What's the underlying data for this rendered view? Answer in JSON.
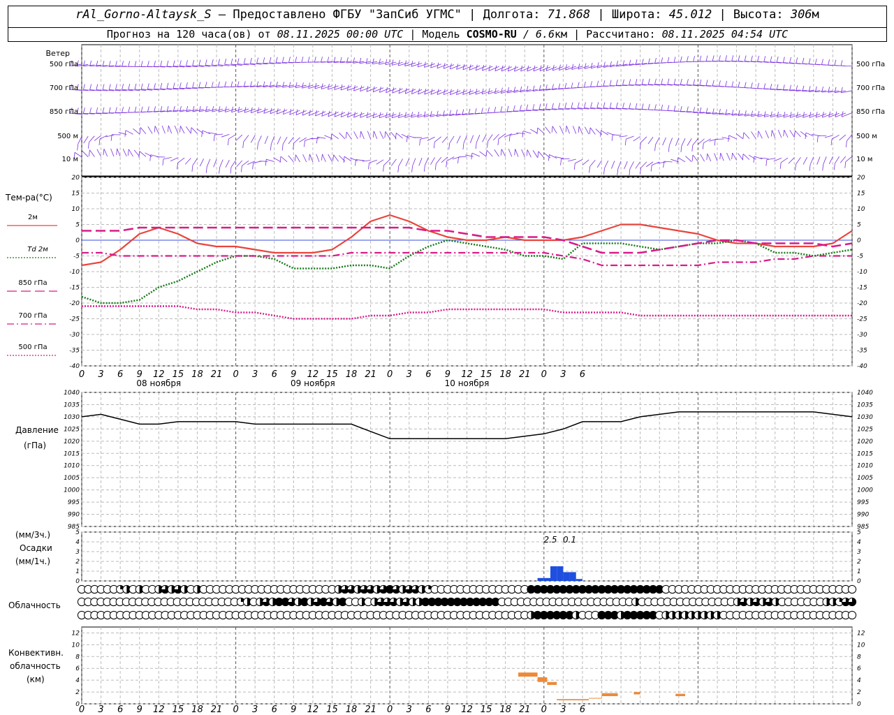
{
  "header": {
    "station": "rAl_Gorno-Altaysk_S",
    "provider_prefix": "— Предоставлено ФГБУ \"ЗапСиб УГМС\" | Долгота:",
    "longitude": "71.868",
    "lat_label": "| Широта:",
    "latitude": "45.012",
    "alt_label": "| Высота:",
    "altitude": "306",
    "alt_unit": "м",
    "forecast_prefix": "Прогноз на 120 часа(ов) от",
    "run_time": "08.11.2025 00:00 UTC",
    "model_label": "| Модель",
    "model_name": "COSMO-RU",
    "model_res": "/ 6.6",
    "model_res_unit": "км",
    "computed_label": "| Рассчитано:",
    "computed_time": "08.11.2025 04:54 UTC"
  },
  "labels": {
    "wind": "Ветер",
    "wind_levels": [
      "500 гПа",
      "700 гПа",
      "850 гПа",
      "500 м",
      "10  м"
    ],
    "temp_title": "Тем-ра(°C)",
    "temp_legend": [
      "2м",
      "Td  2м",
      "850 гПа",
      "700 гПа",
      "500 гПа"
    ],
    "pressure_title": "Давление",
    "pressure_unit": "(гПа)",
    "precip_unit_3h": "(мм/3ч.)",
    "precip_title": "Осадки",
    "precip_unit_1h": "(мм/1ч.)",
    "cloud_title": "Облачность",
    "conv_title_1": "Конвективн.",
    "conv_title_2": "облачность",
    "conv_unit": "(км)",
    "day_labels": [
      "08 ноября",
      "09 ноября",
      "10 ноября"
    ],
    "precip_value_labels": [
      "2.5",
      "0.1"
    ]
  },
  "colors": {
    "t2m": "#e8453c",
    "td2m": "#1a7a1a",
    "t850": "#d81b8a",
    "t700": "#d81b8a",
    "t500": "#d81b8a",
    "pressure": "#000000",
    "precip": "#1f4fe0",
    "conv": "#ec8a3a",
    "wind": "#7a2ee0",
    "zero_line": "#3a4ddb"
  },
  "chart_data": [
    {
      "type": "line",
      "title": "Тем-ра(°C)",
      "x_hours": [
        0,
        3,
        6,
        9,
        12,
        15,
        18,
        21,
        24,
        27,
        30,
        33,
        36,
        39,
        42,
        45,
        48,
        51,
        54,
        57,
        60,
        63,
        66,
        69,
        72,
        75,
        78,
        81,
        84,
        87,
        90,
        93,
        96,
        99,
        102,
        105,
        108,
        111,
        114,
        117,
        120
      ],
      "x_ticks": [
        "0",
        "3",
        "6",
        "9",
        "12",
        "15",
        "18",
        "21",
        "0",
        "3",
        "6",
        "9",
        "12",
        "15",
        "18",
        "21",
        "0",
        "3",
        "6",
        "9",
        "12",
        "15",
        "18",
        "21",
        "0",
        "3",
        "6"
      ],
      "ylim": [
        -40,
        20
      ],
      "yticks": [
        -40,
        -35,
        -30,
        -25,
        -20,
        -15,
        -10,
        -5,
        0,
        5,
        10,
        15,
        20
      ],
      "series": [
        {
          "name": "2м",
          "style": "solid",
          "values": [
            -8,
            -7,
            -3,
            2,
            4,
            2,
            -1,
            -2,
            -2,
            -3,
            -4,
            -4,
            -4,
            -3,
            1,
            6,
            8,
            6,
            3,
            1,
            0,
            0,
            1,
            0,
            0,
            0,
            1,
            3,
            5,
            5,
            4,
            3,
            2,
            0,
            -1,
            -1,
            -2,
            -2,
            -2,
            -1,
            3
          ]
        },
        {
          "name": "Td  2м",
          "style": "dotted",
          "values": [
            -18,
            -20,
            -20,
            -19,
            -15,
            -13,
            -10,
            -7,
            -5,
            -5,
            -6,
            -9,
            -9,
            -9,
            -8,
            -8,
            -9,
            -5,
            -2,
            0,
            -1,
            -2,
            -3,
            -5,
            -5,
            -6,
            -1,
            -1,
            -1,
            -2,
            -3,
            -2,
            -1,
            -1,
            0,
            -1,
            -4,
            -4,
            -5,
            -4,
            -3
          ]
        },
        {
          "name": "850 гПа",
          "style": "dashed",
          "values": [
            3,
            3,
            3,
            4,
            4,
            4,
            4,
            4,
            4,
            4,
            4,
            4,
            4,
            4,
            4,
            4,
            4,
            4,
            3,
            3,
            2,
            1,
            1,
            1,
            1,
            0,
            -2,
            -4,
            -4,
            -4,
            -3,
            -2,
            -1,
            0,
            0,
            -1,
            -1,
            -1,
            -1,
            -2,
            -1
          ]
        },
        {
          "name": "700 гПа",
          "style": "dashdot",
          "values": [
            -4,
            -4,
            -5,
            -5,
            -5,
            -5,
            -5,
            -5,
            -5,
            -5,
            -5,
            -5,
            -5,
            -5,
            -4,
            -4,
            -4,
            -4,
            -4,
            -4,
            -4,
            -4,
            -4,
            -4,
            -4,
            -5,
            -6,
            -8,
            -8,
            -8,
            -8,
            -8,
            -8,
            -7,
            -7,
            -7,
            -6,
            -6,
            -5,
            -5,
            -5
          ]
        },
        {
          "name": "500 гПа",
          "style": "fine-dotted",
          "values": [
            -21,
            -21,
            -21,
            -21,
            -21,
            -21,
            -22,
            -22,
            -23,
            -23,
            -24,
            -25,
            -25,
            -25,
            -25,
            -24,
            -24,
            -23,
            -23,
            -22,
            -22,
            -22,
            -22,
            -22,
            -22,
            -23,
            -23,
            -23,
            -23,
            -24,
            -24,
            -24,
            -24,
            -24,
            -24,
            -24,
            -24,
            -24,
            -24,
            -24,
            -24
          ]
        }
      ]
    },
    {
      "type": "line",
      "title": "Давление",
      "ylabel": "(гПа)",
      "ylim": [
        985,
        1040
      ],
      "yticks": [
        985,
        990,
        995,
        1000,
        1005,
        1010,
        1015,
        1020,
        1025,
        1030,
        1035,
        1040
      ],
      "x_hours": [
        0,
        3,
        6,
        9,
        12,
        15,
        18,
        21,
        24,
        27,
        30,
        33,
        36,
        39,
        42,
        45,
        48,
        51,
        54,
        57,
        60,
        63,
        66,
        69,
        72,
        75,
        78,
        81,
        84,
        87,
        90,
        93,
        96,
        99,
        102,
        105,
        108,
        111,
        114,
        117,
        120
      ],
      "series": [
        {
          "name": "",
          "values": [
            1030,
            1031,
            1029,
            1027,
            1027,
            1028,
            1028,
            1028,
            1028,
            1027,
            1027,
            1027,
            1027,
            1027,
            1027,
            1024,
            1021,
            1021,
            1021,
            1021,
            1021,
            1021,
            1021,
            1022,
            1023,
            1025,
            1028,
            1028,
            1028,
            1030,
            1031,
            1032,
            1032,
            1032,
            1032,
            1032,
            1032,
            1032,
            1032,
            1031,
            1030
          ]
        }
      ]
    },
    {
      "type": "bar",
      "title": "Осадки",
      "ylabel": "(мм/1ч.)",
      "ylim": [
        0,
        5
      ],
      "yticks": [
        0,
        1,
        2,
        3,
        4,
        5
      ],
      "bars_hour_mm": [
        [
          71.5,
          0.3
        ],
        [
          72.5,
          0.3
        ],
        [
          73.5,
          1.5
        ],
        [
          74.5,
          1.5
        ],
        [
          75.5,
          0.9
        ],
        [
          76.5,
          0.9
        ],
        [
          77.5,
          0.2
        ]
      ],
      "labels_3h": [
        {
          "hour": 72,
          "text": "2.5"
        },
        {
          "hour": 75,
          "text": "0.1"
        }
      ]
    },
    {
      "type": "heatmap",
      "title": "Облачность",
      "note": "cloud octas 0-8 per hour for three layers (low, middle, high)",
      "rows": [
        [
          0,
          0,
          0,
          0,
          0,
          0,
          2,
          4,
          0,
          4,
          0,
          0,
          4,
          6,
          4,
          6,
          4,
          0,
          4,
          0,
          0,
          0,
          0,
          0,
          0,
          0,
          0,
          0,
          0,
          0,
          0,
          0,
          0,
          0,
          0,
          0,
          0,
          0,
          0,
          0,
          4,
          6,
          6,
          4,
          6,
          6,
          4,
          6,
          8,
          6,
          4,
          6,
          6,
          4,
          2,
          0,
          0,
          0,
          0,
          0,
          0,
          0,
          0,
          0,
          0,
          0,
          0,
          0,
          0,
          0,
          8,
          8,
          8,
          8,
          8,
          8,
          8,
          8,
          8,
          8,
          8,
          8,
          8,
          8,
          8,
          8,
          8,
          8,
          8,
          8,
          8,
          0,
          0,
          0,
          0,
          0,
          0,
          0,
          0,
          0,
          0,
          0,
          0,
          0,
          0,
          0,
          0,
          0,
          0,
          0,
          0,
          0,
          0,
          0,
          0,
          0,
          0,
          0,
          0,
          0,
          0
        ],
        [
          0,
          0,
          0,
          0,
          0,
          0,
          0,
          0,
          0,
          0,
          0,
          0,
          0,
          0,
          0,
          0,
          0,
          0,
          0,
          0,
          0,
          0,
          0,
          0,
          0,
          2,
          4,
          0,
          4,
          6,
          4,
          8,
          8,
          6,
          4,
          8,
          4,
          6,
          8,
          6,
          4,
          8,
          0,
          0,
          4,
          0,
          4,
          6,
          6,
          6,
          4,
          6,
          4,
          4,
          8,
          8,
          8,
          8,
          8,
          8,
          8,
          8,
          8,
          8,
          8,
          8,
          0,
          0,
          0,
          0,
          0,
          0,
          0,
          0,
          0,
          0,
          0,
          0,
          0,
          0,
          0,
          0,
          0,
          0,
          0,
          0,
          0,
          4,
          0,
          0,
          0,
          0,
          0,
          0,
          0,
          0,
          0,
          0,
          0,
          0,
          0,
          0,
          0,
          4,
          6,
          4,
          6,
          4,
          6,
          4,
          0,
          0,
          0,
          0,
          0,
          0,
          0,
          4,
          4,
          2,
          6,
          6
        ],
        [
          0,
          0,
          0,
          0,
          0,
          0,
          0,
          0,
          0,
          0,
          0,
          0,
          0,
          0,
          0,
          0,
          0,
          0,
          0,
          0,
          0,
          0,
          0,
          0,
          0,
          0,
          0,
          0,
          0,
          0,
          0,
          0,
          0,
          0,
          0,
          0,
          0,
          0,
          0,
          0,
          0,
          0,
          0,
          0,
          0,
          0,
          0,
          0,
          0,
          0,
          0,
          0,
          0,
          0,
          0,
          0,
          0,
          0,
          0,
          0,
          0,
          0,
          0,
          0,
          0,
          0,
          0,
          0,
          0,
          0,
          4,
          8,
          8,
          8,
          8,
          8,
          8,
          4,
          0,
          0,
          0,
          8,
          8,
          8,
          4,
          8,
          8,
          8,
          8,
          8,
          0,
          4,
          4,
          4,
          4,
          4,
          4,
          4,
          4,
          4,
          0,
          0,
          0,
          0,
          0,
          0,
          0,
          0,
          0,
          0,
          0,
          0,
          0,
          0,
          0,
          0,
          0,
          0,
          0,
          0,
          0
        ]
      ]
    },
    {
      "type": "bar",
      "title": "Конвективн. облачность",
      "ylabel": "(км)",
      "ylim": [
        0,
        13
      ],
      "yticks": [
        0,
        2,
        4,
        6,
        8,
        10,
        12
      ],
      "segments_hour_km": [
        {
          "start": 68,
          "end": 71,
          "base": 4.6,
          "top": 5.3
        },
        {
          "start": 71,
          "end": 72.5,
          "base": 3.7,
          "top": 4.5
        },
        {
          "start": 72.5,
          "end": 74,
          "base": 3.2,
          "top": 3.7
        },
        {
          "start": 74,
          "end": 79,
          "base": 0.6,
          "top": 0.8
        },
        {
          "start": 79,
          "end": 81,
          "base": 0.9,
          "top": 1.0
        },
        {
          "start": 81,
          "end": 83.5,
          "base": 1.3,
          "top": 1.8
        },
        {
          "start": 86,
          "end": 87,
          "base": 1.6,
          "top": 2.0
        },
        {
          "start": 92.5,
          "end": 94,
          "base": 1.3,
          "top": 1.7
        }
      ]
    }
  ]
}
